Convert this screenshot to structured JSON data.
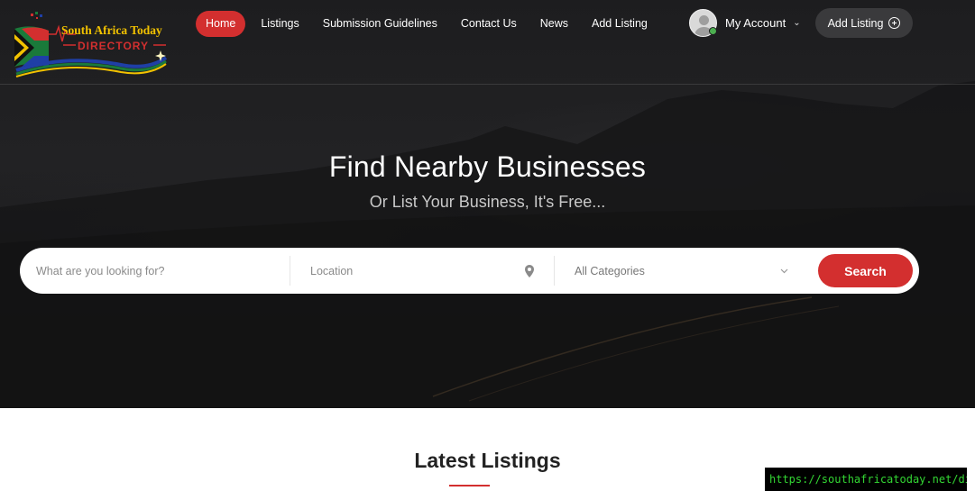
{
  "brand": {
    "name_line1": "South Africa Today",
    "name_line2": "DIRECTORY"
  },
  "nav": {
    "items": [
      {
        "label": "Home",
        "active": true
      },
      {
        "label": "Listings",
        "active": false
      },
      {
        "label": "Submission Guidelines",
        "active": false
      },
      {
        "label": "Contact Us",
        "active": false
      },
      {
        "label": "News",
        "active": false
      },
      {
        "label": "Add Listing",
        "active": false
      }
    ]
  },
  "account": {
    "label": "My Account",
    "status": "online"
  },
  "header_button": {
    "label": "Add Listing",
    "icon": "plus-circle-icon"
  },
  "hero": {
    "title": "Find Nearby Businesses",
    "subtitle": "Or List Your Business, It's Free..."
  },
  "search": {
    "what_placeholder": "What are you looking for?",
    "location_placeholder": "Location",
    "location_icon": "map-pin-icon",
    "category_selected": "All Categories",
    "button_label": "Search"
  },
  "latest": {
    "title": "Latest Listings"
  },
  "status_bar": {
    "url": "https://southafricatoday.net/directory/"
  },
  "colors": {
    "accent": "#d32f2f",
    "dark_bg": "#1d1d1f",
    "button_dark": "#3a3a3c",
    "status_text": "#33d633"
  }
}
